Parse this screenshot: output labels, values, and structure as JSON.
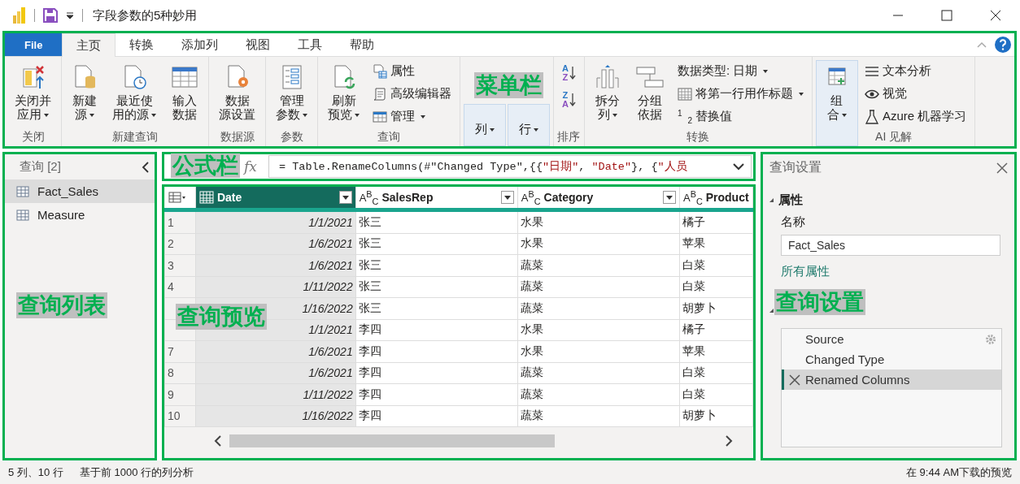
{
  "title_bar": {
    "title": "字段参数的5种妙用"
  },
  "ribbon": {
    "annotation": "菜单栏",
    "tabs": [
      {
        "label": "File",
        "kind": "file",
        "selected": false
      },
      {
        "label": "主页",
        "kind": "tab",
        "selected": true
      },
      {
        "label": "转换",
        "kind": "tab",
        "selected": false
      },
      {
        "label": "添加列",
        "kind": "tab",
        "selected": false
      },
      {
        "label": "视图",
        "kind": "tab",
        "selected": false
      },
      {
        "label": "工具",
        "kind": "tab",
        "selected": false
      },
      {
        "label": "帮助",
        "kind": "tab",
        "selected": false
      }
    ],
    "groups": [
      {
        "label": "关闭",
        "items": [
          {
            "kind": "large",
            "lines": [
              "关闭并",
              "应用"
            ],
            "dropdown": true,
            "highlighted": false
          }
        ]
      },
      {
        "label": "新建查询",
        "items": [
          {
            "kind": "large",
            "lines": [
              "新建",
              "源"
            ],
            "dropdown": true,
            "highlighted": false
          },
          {
            "kind": "large",
            "lines": [
              "最近使",
              "用的源"
            ],
            "dropdown": true,
            "highlighted": false
          },
          {
            "kind": "large",
            "lines": [
              "输入",
              "数据"
            ],
            "dropdown": false,
            "highlighted": false
          }
        ]
      },
      {
        "label": "数据源",
        "items": [
          {
            "kind": "large",
            "lines": [
              "数据",
              "源设置"
            ],
            "dropdown": false,
            "highlighted": false
          }
        ]
      },
      {
        "label": "参数",
        "items": [
          {
            "kind": "large",
            "lines": [
              "管理",
              "参数"
            ],
            "dropdown": true,
            "highlighted": false
          }
        ]
      },
      {
        "label": "查询",
        "items": [
          {
            "kind": "large",
            "lines": [
              "刷新",
              "预览"
            ],
            "dropdown": true,
            "highlighted": false
          },
          {
            "kind": "small",
            "label": "属性",
            "dropdown": false
          },
          {
            "kind": "small",
            "label": "高级编辑器",
            "dropdown": false
          },
          {
            "kind": "small",
            "label": "管理",
            "dropdown": true
          }
        ]
      },
      {
        "items": [
          {
            "kind": "large",
            "lines": [
              "列"
            ],
            "dropdown": true,
            "highlighted": true
          },
          {
            "kind": "large",
            "lines": [
              "行"
            ],
            "dropdown": true,
            "highlighted": true
          }
        ]
      },
      {
        "label": "排序",
        "items": [
          {
            "kind": "sort",
            "letters": [
              "A",
              "Z"
            ]
          },
          {
            "kind": "sort",
            "letters": [
              "Z",
              "A"
            ]
          }
        ]
      },
      {
        "label": "转换",
        "items": [
          {
            "kind": "large",
            "lines": [
              "拆分",
              "列"
            ],
            "dropdown": true,
            "highlighted": false
          },
          {
            "kind": "large",
            "lines": [
              "分组",
              "依据"
            ],
            "dropdown": false,
            "highlighted": false
          },
          {
            "kind": "small",
            "label": "数据类型: 日期",
            "dropdown": true
          },
          {
            "kind": "small",
            "label": "将第一行用作标题",
            "dropdown": true
          },
          {
            "kind": "small",
            "label": "替换值",
            "dropdown": false,
            "icon_digits": [
              "1",
              "2"
            ]
          }
        ]
      },
      {
        "label": "AI 见解",
        "items": [
          {
            "kind": "large",
            "lines": [
              "组",
              "合"
            ],
            "dropdown": true,
            "highlighted": true
          },
          {
            "kind": "small",
            "label": "文本分析",
            "dropdown": false
          },
          {
            "kind": "small",
            "label": "视觉",
            "dropdown": false
          },
          {
            "kind": "small",
            "label": "Azure 机器学习",
            "dropdown": false
          }
        ]
      }
    ]
  },
  "queries": {
    "title": "查询 [2]",
    "annotation": "查询列表",
    "items": [
      {
        "label": "Fact_Sales",
        "selected": true
      },
      {
        "label": "Measure",
        "selected": false
      }
    ]
  },
  "formula_bar": {
    "annotation": "公式栏",
    "fx": "fx",
    "tokens": [
      {
        "kind": "plain",
        "text": "= Table.RenameColumns(#\"Changed Type\",{{"
      },
      {
        "kind": "string",
        "text": "\"日期\""
      },
      {
        "kind": "plain",
        "text": ", "
      },
      {
        "kind": "string",
        "text": "\"Date\""
      },
      {
        "kind": "plain",
        "text": "}, {"
      },
      {
        "kind": "string",
        "text": "\"人员"
      }
    ]
  },
  "preview": {
    "annotation": "查询预览",
    "columns": [
      {
        "name": "Date",
        "kind": "date",
        "selected": true
      },
      {
        "name": "SalesRep",
        "kind": "text",
        "type_badge": "A$^{B}$$_{C}$",
        "selected": false
      },
      {
        "name": "Category",
        "kind": "text",
        "type_badge": "A$^{B}$$_{C}$",
        "selected": false
      },
      {
        "name": "Product",
        "kind": "text",
        "type_badge": "A$^{B}$$_{C}$",
        "selected": false
      }
    ],
    "rows": [
      {
        "number": "1",
        "cells": [
          "1/1/2021",
          "张三",
          "水果",
          "橘子"
        ]
      },
      {
        "number": "2",
        "cells": [
          "1/6/2021",
          "张三",
          "水果",
          "苹果"
        ]
      },
      {
        "number": "3",
        "cells": [
          "1/6/2021",
          "张三",
          "蔬菜",
          "白菜"
        ]
      },
      {
        "number": "4",
        "cells": [
          "1/11/2022",
          "张三",
          "蔬菜",
          "白菜"
        ]
      },
      {
        "cells": [
          "1/16/2022",
          "张三",
          "蔬菜",
          "胡萝卜"
        ]
      },
      {
        "cells": [
          "1/1/2021",
          "李四",
          "水果",
          "橘子"
        ]
      },
      {
        "number": "7",
        "cells": [
          "1/6/2021",
          "李四",
          "水果",
          "苹果"
        ]
      },
      {
        "number": "8",
        "cells": [
          "1/6/2021",
          "李四",
          "蔬菜",
          "白菜"
        ]
      },
      {
        "number": "9",
        "cells": [
          "1/11/2022",
          "李四",
          "蔬菜",
          "白菜"
        ]
      },
      {
        "number": "10",
        "cells": [
          "1/16/2022",
          "李四",
          "蔬菜",
          "胡萝卜"
        ]
      }
    ]
  },
  "settings": {
    "title": "查询设置",
    "annotation": "查询设置",
    "properties": {
      "heading": "属性",
      "name_label": "名称",
      "name_value": "Fact_Sales",
      "link": "所有属性"
    },
    "steps": [
      {
        "label": "Source",
        "selected": false,
        "settings": true
      },
      {
        "label": "Changed Type",
        "selected": false,
        "settings": false
      },
      {
        "label": "Renamed Columns",
        "selected": true,
        "settings": false
      }
    ]
  },
  "status_bar": {
    "left": [
      "5 列、10 行",
      "基于前 1000 行的列分析"
    ],
    "right": "在 9:44 AM下载的预览"
  }
}
